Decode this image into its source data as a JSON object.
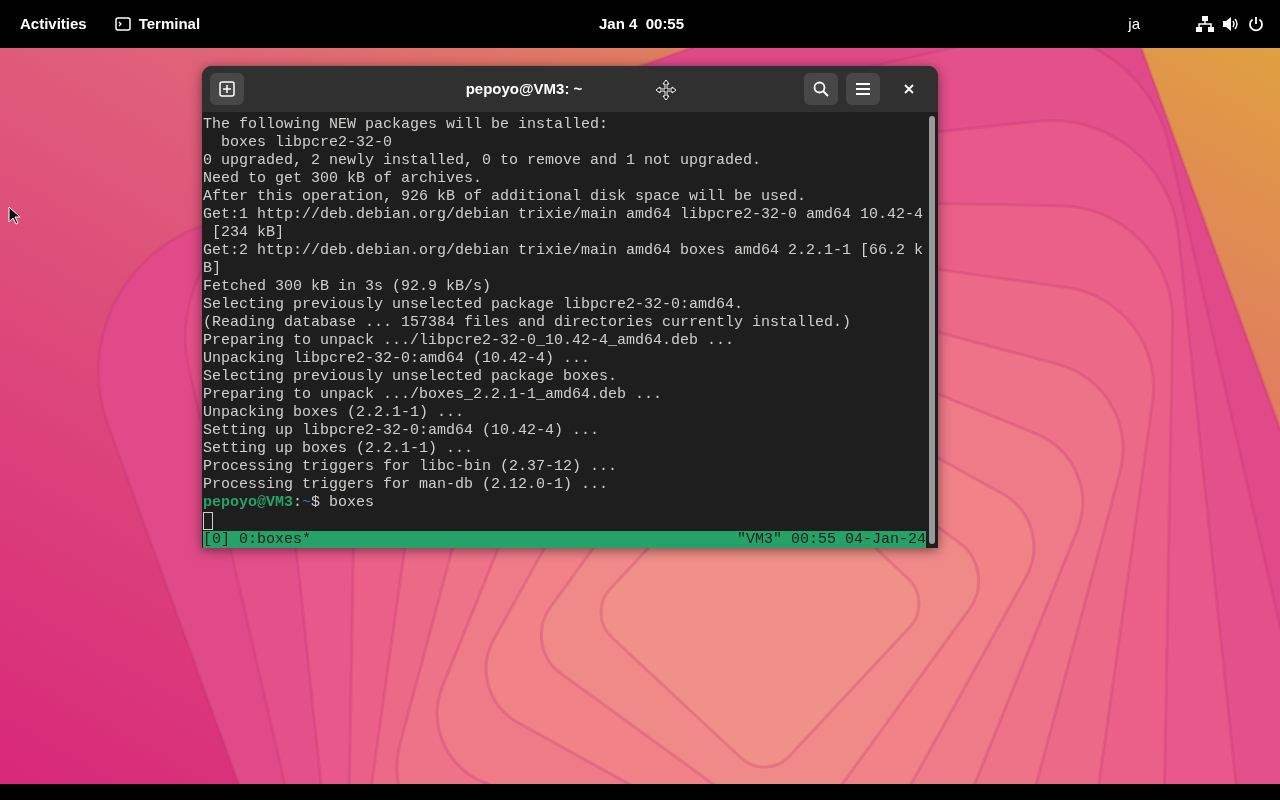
{
  "top_bar": {
    "activities": "Activities",
    "app": "Terminal",
    "clock": "Jan 4  00:55",
    "input_method": "ja"
  },
  "window": {
    "title": "pepoyo@VM3: ~"
  },
  "terminal": {
    "lines": [
      "The following NEW packages will be installed:",
      "  boxes libpcre2-32-0",
      "0 upgraded, 2 newly installed, 0 to remove and 1 not upgraded.",
      "Need to get 300 kB of archives.",
      "After this operation, 926 kB of additional disk space will be used.",
      "Get:1 http://deb.debian.org/debian trixie/main amd64 libpcre2-32-0 amd64 10.42-4",
      " [234 kB]",
      "Get:2 http://deb.debian.org/debian trixie/main amd64 boxes amd64 2.2.1-1 [66.2 k",
      "B]",
      "Fetched 300 kB in 3s (92.9 kB/s)",
      "Selecting previously unselected package libpcre2-32-0:amd64.",
      "(Reading database ... 157384 files and directories currently installed.)",
      "Preparing to unpack .../libpcre2-32-0_10.42-4_amd64.deb ...",
      "Unpacking libpcre2-32-0:amd64 (10.42-4) ...",
      "Selecting previously unselected package boxes.",
      "Preparing to unpack .../boxes_2.2.1-1_amd64.deb ...",
      "Unpacking boxes (2.2.1-1) ...",
      "Setting up libpcre2-32-0:amd64 (10.42-4) ...",
      "Setting up boxes (2.2.1-1) ...",
      "Processing triggers for libc-bin (2.37-12) ...",
      "Processing triggers for man-db (2.12.0-1) ..."
    ],
    "prompt": [
      {
        "kind": "user",
        "text": "pepoyo@VM3"
      },
      {
        "kind": "plain",
        "text": ":"
      },
      {
        "kind": "path",
        "text": "~"
      },
      {
        "kind": "plain",
        "text": "$ boxes"
      }
    ],
    "status_bar": {
      "left": "[0] 0:boxes*",
      "right": "\"VM3\" 00:55 04-Jan-24"
    }
  }
}
